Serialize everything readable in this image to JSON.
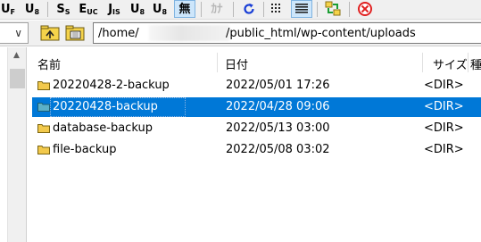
{
  "toolbar": {
    "buttons": [
      {
        "big": "U",
        "small": "F"
      },
      {
        "big": "U",
        "small": "8"
      },
      {
        "big": "S",
        "small": "S"
      },
      {
        "big": "E",
        "small": "UC"
      },
      {
        "big": "J",
        "small": "IS"
      },
      {
        "big": "U",
        "small": "8"
      },
      {
        "big": "U",
        "small": "8"
      },
      {
        "big": "無",
        "small": ""
      },
      {
        "big": "ｶﾅ",
        "small": ""
      }
    ]
  },
  "address_bar": {
    "path_start": "/home/",
    "path_end": "/public_html/wp-content/uploads"
  },
  "columns": {
    "name": "名前",
    "date": "日付",
    "size": "サイズ",
    "extra": "種"
  },
  "files": [
    {
      "name": "20220428-2-backup",
      "date": "2022/05/01 17:26",
      "size": "<DIR>",
      "selected": false
    },
    {
      "name": "20220428-backup",
      "date": "2022/04/28 09:06",
      "size": "<DIR>",
      "selected": true
    },
    {
      "name": "database-backup",
      "date": "2022/05/13 03:00",
      "size": "<DIR>",
      "selected": false
    },
    {
      "name": "file-backup",
      "date": "2022/05/08 03:02",
      "size": "<DIR>",
      "selected": false
    }
  ],
  "colors": {
    "selection": "#0078d7",
    "folder": "#f2c94c",
    "folder_selected": "#5bb0c8"
  }
}
